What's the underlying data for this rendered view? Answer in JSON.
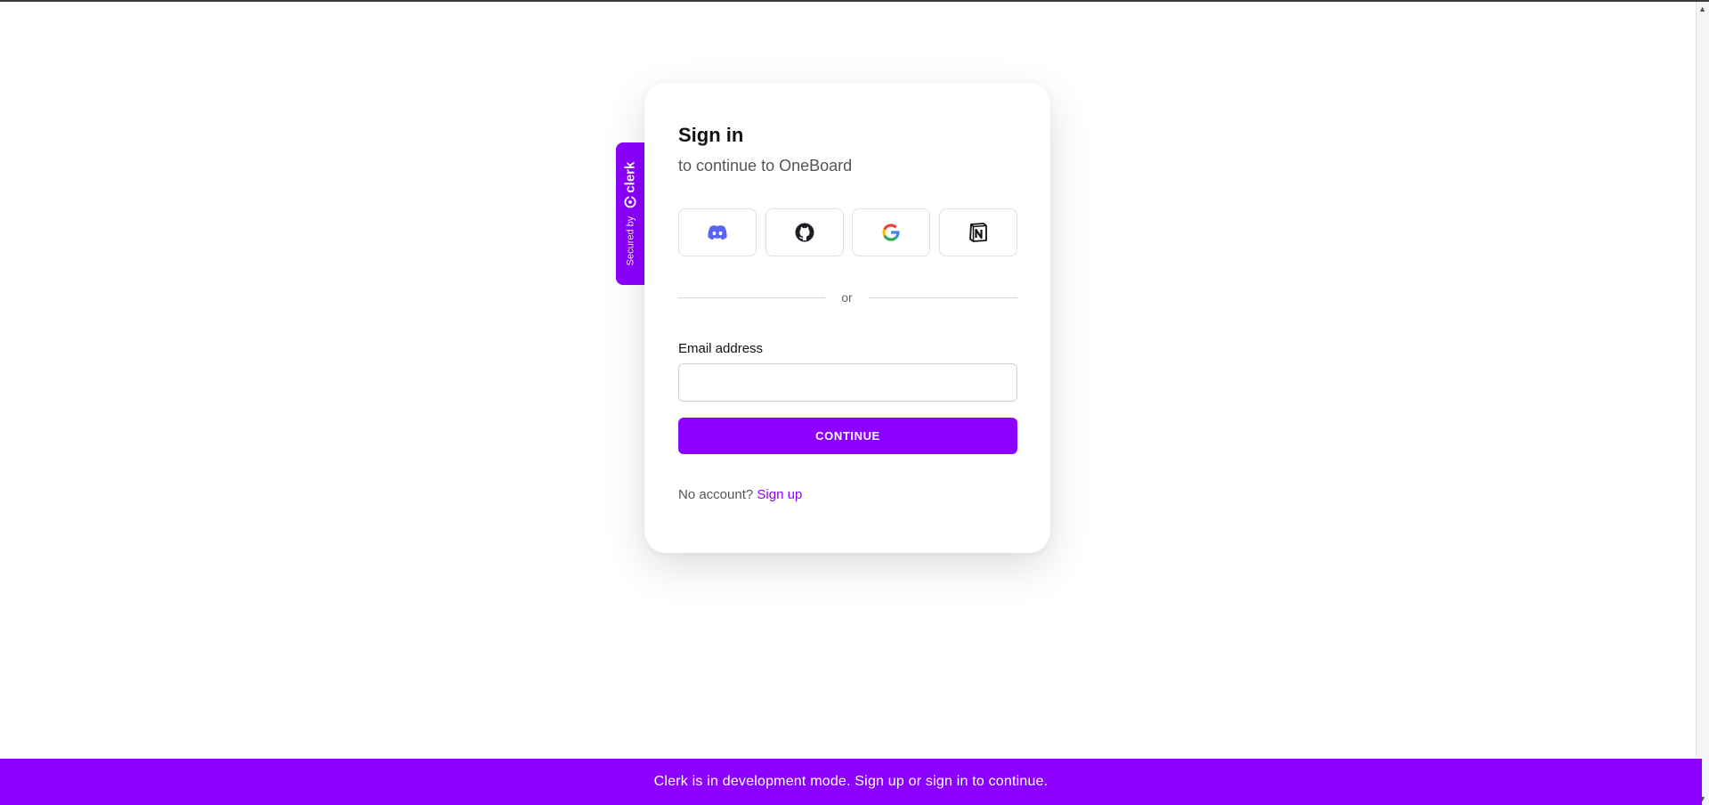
{
  "badge": {
    "secured_text": "Secured by",
    "brand_text": "clerk",
    "color": "#8b00ff"
  },
  "card": {
    "title": "Sign in",
    "subtitle": "to continue to OneBoard",
    "social_providers": [
      {
        "name": "Discord",
        "icon": "discord-icon"
      },
      {
        "name": "GitHub",
        "icon": "github-icon"
      },
      {
        "name": "Google",
        "icon": "google-icon"
      },
      {
        "name": "Notion",
        "icon": "notion-icon"
      }
    ],
    "divider_text": "or",
    "email_label": "Email address",
    "email_value": "",
    "continue_label": "CONTINUE",
    "no_account_text": "No account?",
    "signup_link": "Sign up"
  },
  "banner": {
    "text": "Clerk is in development mode. Sign up or sign in to continue."
  },
  "colors": {
    "accent": "#8b00ff",
    "background": "#ffffff"
  }
}
